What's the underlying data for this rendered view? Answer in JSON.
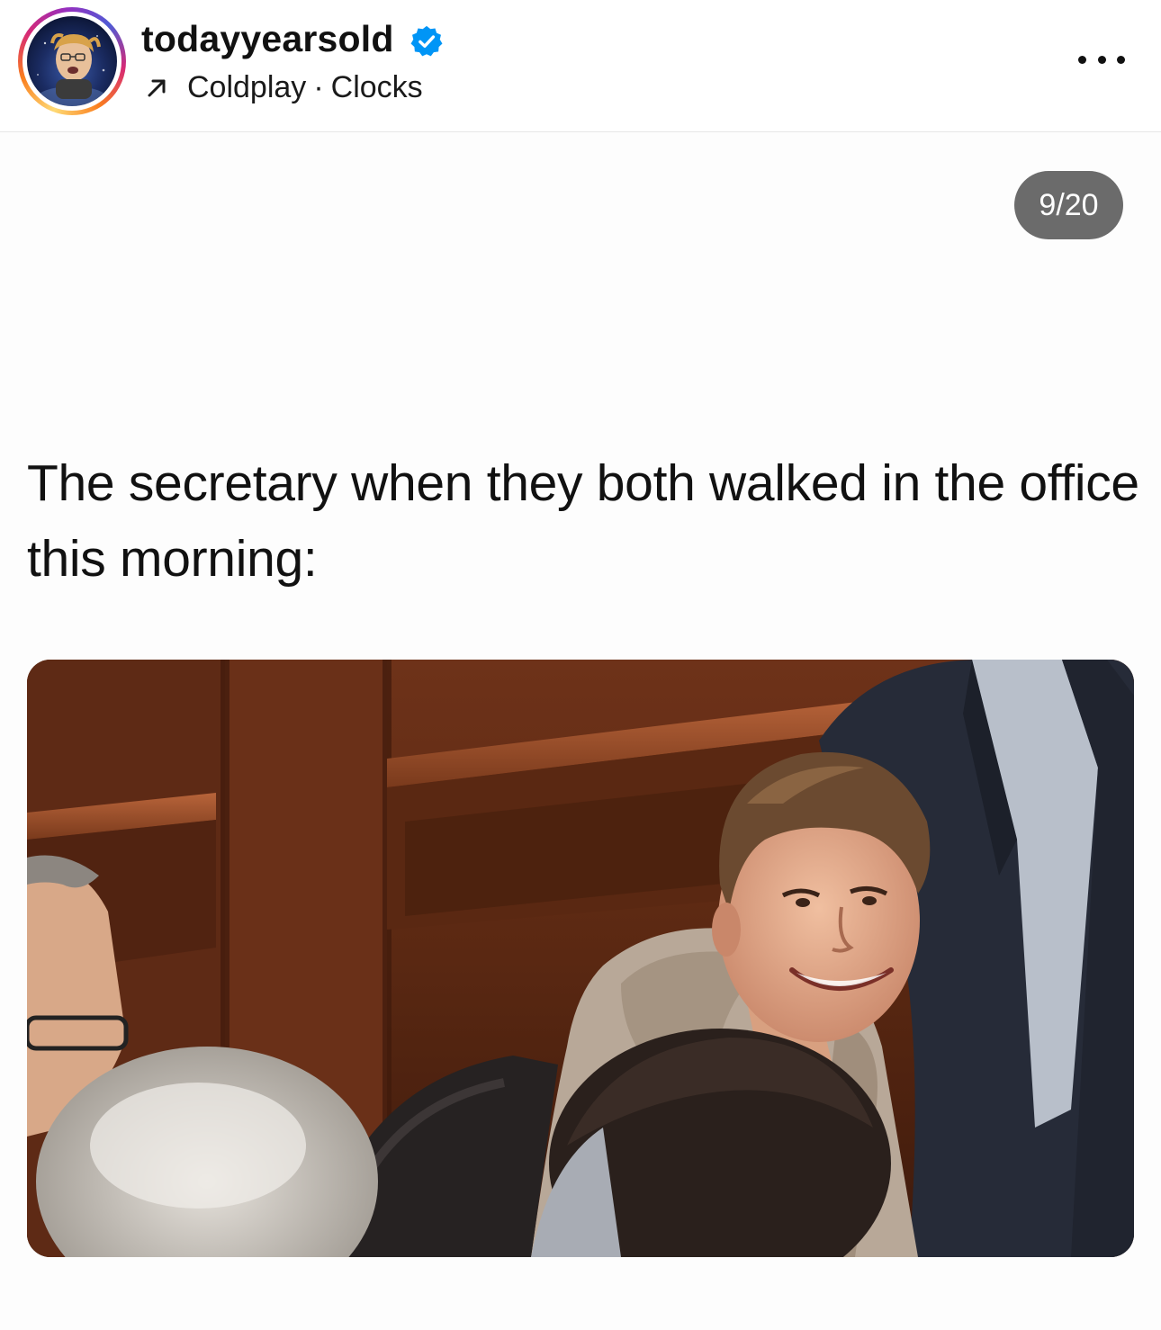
{
  "header": {
    "username": "todayyearsold",
    "verified": true,
    "audio": {
      "artist": "Coldplay",
      "separator": "·",
      "track": "Clocks"
    },
    "icons": {
      "avatar": "avatar-image",
      "verified": "verified-badge-icon",
      "audio": "arrow-up-right-icon",
      "more": "more-horizontal-icon"
    }
  },
  "post": {
    "counter": "9/20",
    "caption": "The secretary when they both walked in the office this morning:",
    "photo_description": "photo-image"
  },
  "colors": {
    "verified_blue": "#0095f6",
    "counter_bg": "#6b6b6b",
    "text": "#111111"
  }
}
